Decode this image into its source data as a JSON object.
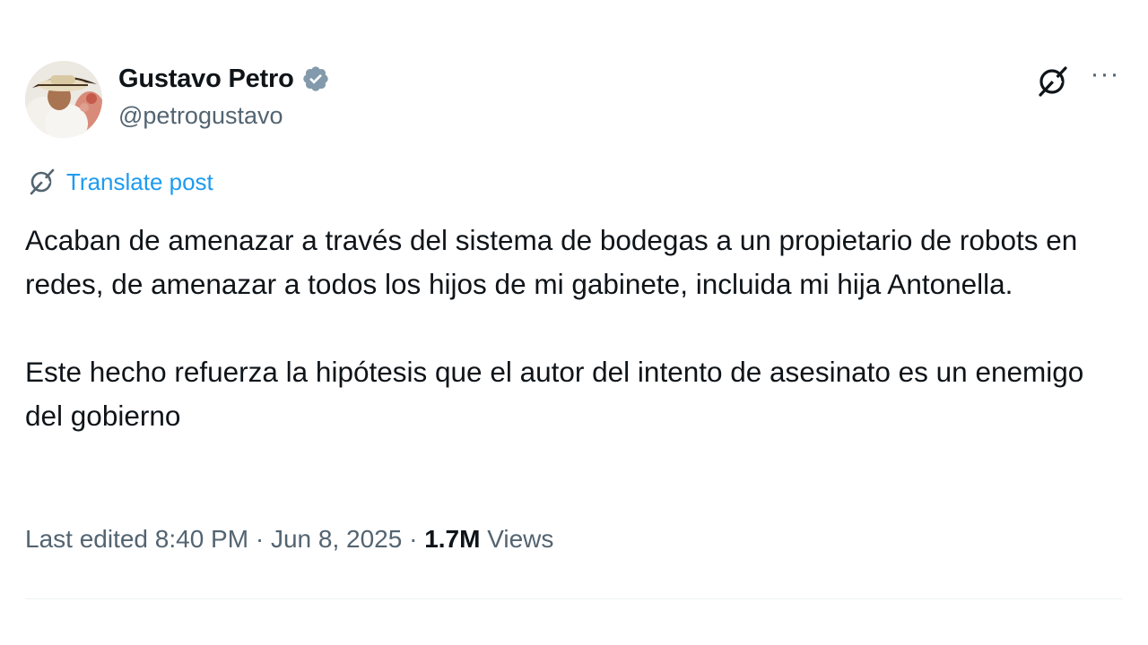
{
  "author": {
    "name": "Gustavo Petro",
    "handle": "@petrogustavo",
    "verified": true
  },
  "icons": {
    "avatar": "profile-photo",
    "verified": "verified-badge-icon",
    "grok": "grok-icon",
    "more": "more-options-icon",
    "translate": "grok-translate-icon"
  },
  "colors": {
    "accent": "#1d9bf0",
    "muted": "#536471",
    "text": "#0f1419"
  },
  "translate_label": "Translate post",
  "post": {
    "paragraphs": [
      "Acaban de amenazar a través del sistema de bodegas a un propietario de robots en redes, de amenazar a todos los hijos de mi gabinete, incluida mi hija Antonella.",
      "Este hecho refuerza la hipótesis que el autor del intento de asesinato es un enemigo del gobierno"
    ]
  },
  "meta": {
    "edited_label": "Last edited",
    "time": "8:40 PM",
    "separator": " · ",
    "date": "Jun 8, 2025",
    "views_count": "1.7M",
    "views_label": "Views"
  },
  "more_glyph": "···"
}
